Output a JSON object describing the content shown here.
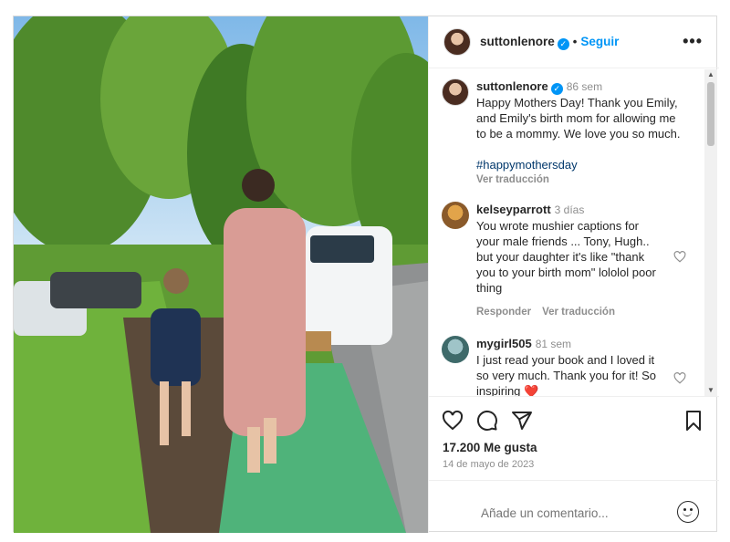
{
  "header": {
    "username": "suttonlenore",
    "separator": "•",
    "follow_label": "Seguir",
    "more_label": "•••"
  },
  "caption": {
    "username": "suttonlenore",
    "time": "86 sem",
    "lines": [
      "Happy Mothers Day! Thank you Emily,",
      "and Emily's birth mom for allowing me",
      "to be a mommy. We love you so much."
    ],
    "hashtag": "#happymothersday",
    "translate": "Ver traducción"
  },
  "comments": [
    {
      "username": "kelseyparrott",
      "time": "3 días",
      "lines": [
        "You wrote mushier captions for",
        "your male friends ... Tony, Hugh..",
        "but your daughter it's like \"thank",
        "you to your birth mom\" lololol poor",
        "thing"
      ],
      "reply": "Responder",
      "translate": "Ver traducción"
    },
    {
      "username": "mygirl505",
      "time": "81 sem",
      "lines": [
        "I just read your book and I loved it",
        "so very much. Thank you for it! So",
        "inspiring"
      ],
      "emoji": "❤️"
    }
  ],
  "actions": {
    "likes": "17.200 Me gusta",
    "date": "14 de mayo de 2023"
  },
  "compose": {
    "placeholder": "Añade un comentario..."
  },
  "scrollbar": {
    "up": "▲",
    "down": "▼"
  },
  "icons": [
    "verified-badge-icon",
    "heart-icon",
    "comment-icon",
    "share-icon",
    "bookmark-icon",
    "emoji-icon",
    "more-icon"
  ],
  "colors": {
    "accent": "#0095f6",
    "text": "#262626",
    "muted": "#8e8e8e",
    "hashtag": "#00376b",
    "heart_red": "#ed4956"
  }
}
